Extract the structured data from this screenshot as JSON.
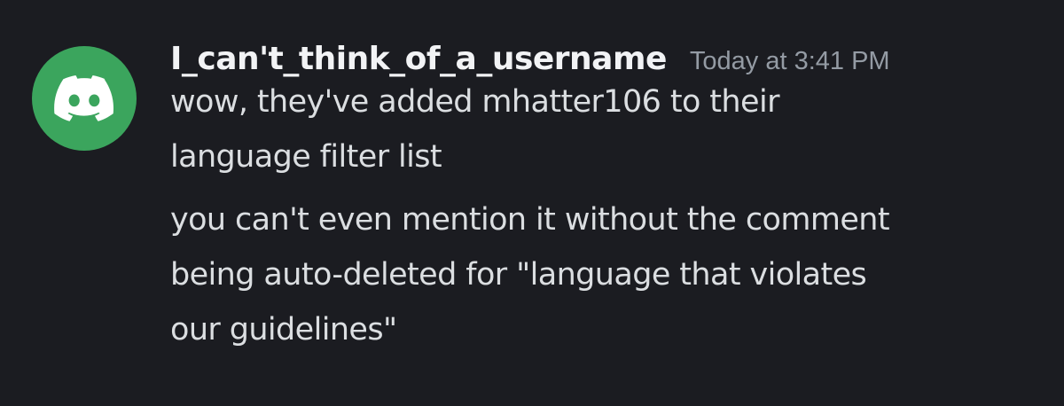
{
  "message": {
    "author": "I_can't_think_of_a_username",
    "timestamp": "Today at 3:41 PM",
    "avatar_icon": "discord-logo-icon",
    "avatar_color": "#3ba55d",
    "paragraphs": [
      {
        "lines": [
          "wow, they've added mhatter106 to their",
          "language filter list"
        ]
      },
      {
        "lines": [
          "you can't even mention it without the comment",
          "being auto-deleted for \"language that violates",
          "our guidelines\""
        ]
      }
    ]
  }
}
